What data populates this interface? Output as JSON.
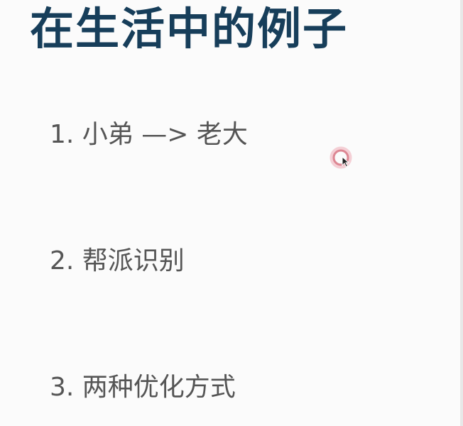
{
  "slide": {
    "title": "在生活中的例子",
    "items": [
      "1. 小弟 —> 老大",
      "2. 帮派识别",
      "3. 两种优化方式"
    ]
  },
  "colors": {
    "background": "#fbfbfb",
    "title": "#173e5a",
    "text": "#555555",
    "cursor_ring": "#d97b88"
  },
  "icons": {
    "cursor": "mouse-pointer-icon",
    "click_ring": "click-highlight-icon"
  }
}
